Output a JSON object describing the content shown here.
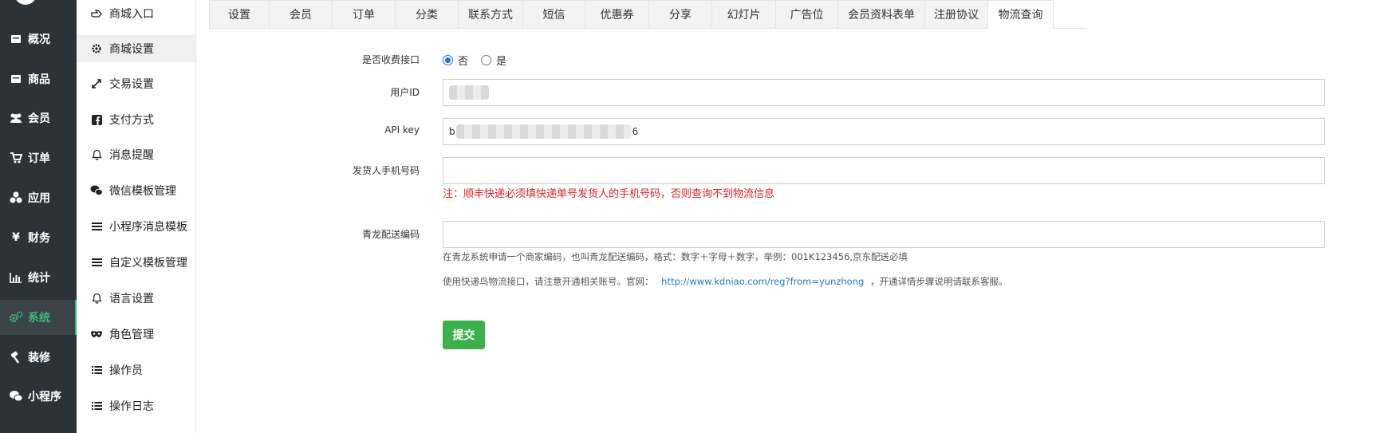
{
  "nav_primary": [
    {
      "label": "概况",
      "icon": "dashboard-icon"
    },
    {
      "label": "商品",
      "icon": "box-icon"
    },
    {
      "label": "会员",
      "icon": "users-icon"
    },
    {
      "label": "订单",
      "icon": "cart-icon"
    },
    {
      "label": "应用",
      "icon": "apps-icon"
    },
    {
      "label": "财务",
      "icon": "yen-icon"
    },
    {
      "label": "统计",
      "icon": "bar-chart-icon"
    },
    {
      "label": "系统",
      "icon": "gears-icon",
      "active": true
    },
    {
      "label": "装修",
      "icon": "hammer-icon"
    },
    {
      "label": "小程序",
      "icon": "wechat-icon"
    }
  ],
  "nav_secondary": [
    {
      "label": "商城入口",
      "icon": "hand-point-icon"
    },
    {
      "label": "商城设置",
      "icon": "gear-icon",
      "active": true
    },
    {
      "label": "交易设置",
      "icon": "exchange-icon"
    },
    {
      "label": "支付方式",
      "icon": "facebook-square-icon"
    },
    {
      "label": "消息提醒",
      "icon": "bell-icon"
    },
    {
      "label": "微信模板管理",
      "icon": "wechat-icon"
    },
    {
      "label": "小程序消息模板",
      "icon": "list-icon"
    },
    {
      "label": "自定义模板管理",
      "icon": "list-icon"
    },
    {
      "label": "语言设置",
      "icon": "bell-icon"
    },
    {
      "label": "角色管理",
      "icon": "mask-icon"
    },
    {
      "label": "操作员",
      "icon": "list-ul-icon"
    },
    {
      "label": "操作日志",
      "icon": "list-ul-icon"
    }
  ],
  "tabs": [
    "设置",
    "会员",
    "订单",
    "分类",
    "联系方式",
    "短信",
    "优惠券",
    "分享",
    "幻灯片",
    "广告位",
    "会员资料表单",
    "注册协议",
    "物流查询"
  ],
  "active_tab": "物流查询",
  "form": {
    "paid_api_label": "是否收费接口",
    "radio_no": "否",
    "radio_yes": "是",
    "user_id_label": "用户ID",
    "api_key_label": "API key",
    "api_key_prefix": "b",
    "api_key_suffix": "6",
    "sender_phone_label": "发货人手机号码",
    "sender_phone_note": "注：顺丰快递必须填快递单号发货人的手机号码，否则查询不到物流信息",
    "qinglong_label": "青龙配送编码",
    "qinglong_help": "在青龙系统申请一个商家编码，也叫青龙配送编码，格式：数字＋字母＋数字，举例：001K123456,京东配送必填",
    "usage_help_prefix": "使用快递鸟物流接口，请注意开通相关账号。官网：",
    "usage_help_link": "http://www.kdniao.com/reg?from=yunzhong",
    "usage_help_suffix": "，开通详情步骤说明请联系客服。",
    "submit_label": "提交"
  },
  "colors": {
    "nav_bg": "#2b3338",
    "active_green": "#3cb878",
    "submit_green": "#3cb04a",
    "note_red": "#e02020",
    "link_blue": "#2a7ab8"
  }
}
